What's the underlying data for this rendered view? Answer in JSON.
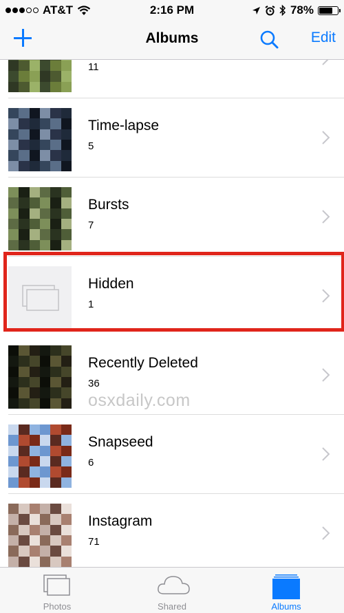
{
  "status_bar": {
    "carrier": "AT&T",
    "time": "2:16 PM",
    "battery": "78%",
    "battery_level": 0.78,
    "signal_bars_filled": 3,
    "signal_bars_total": 5
  },
  "nav": {
    "title": "Albums",
    "edit_label": "Edit"
  },
  "albums": [
    {
      "name": "",
      "count": "11"
    },
    {
      "name": "Time-lapse",
      "count": "5"
    },
    {
      "name": "Bursts",
      "count": "7"
    },
    {
      "name": "Hidden",
      "count": "1"
    },
    {
      "name": "Recently Deleted",
      "count": "36"
    },
    {
      "name": "Snapseed",
      "count": "6"
    },
    {
      "name": "Instagram",
      "count": "71"
    }
  ],
  "watermark": "osxdaily.com",
  "tabs": [
    {
      "label": "Photos",
      "active": false
    },
    {
      "label": "Shared",
      "active": false
    },
    {
      "label": "Albums",
      "active": true
    }
  ],
  "colors": {
    "accent": "#0a7aff",
    "highlight": "#e0251b",
    "bar_background": "#f7f7f7"
  }
}
